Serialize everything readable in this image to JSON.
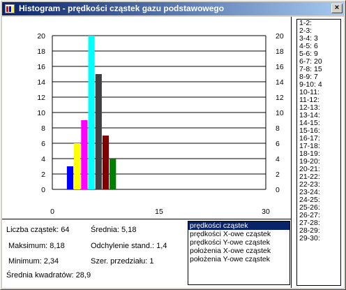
{
  "window": {
    "title": "Histogram - prędkości cząstek gazu podstawowego",
    "close_label": "×"
  },
  "chart_data": {
    "type": "bar",
    "xlim": [
      0,
      30
    ],
    "ylim": [
      0,
      20
    ],
    "x_ticks": [
      "0",
      "15",
      "30"
    ],
    "y_ticks": [
      "0",
      "2",
      "4",
      "6",
      "8",
      "10",
      "12",
      "14",
      "16",
      "18",
      "20"
    ],
    "grid": true,
    "bars": [
      {
        "bin": "2-3",
        "x": 2.5,
        "value": 3,
        "color": "#0000ff"
      },
      {
        "bin": "3-4",
        "x": 3.5,
        "value": 6,
        "color": "#ffff00"
      },
      {
        "bin": "4-5",
        "x": 4.5,
        "value": 9,
        "color": "#ff00ff"
      },
      {
        "bin": "5-6",
        "x": 5.5,
        "value": 20,
        "color": "#00ffff"
      },
      {
        "bin": "6-7",
        "x": 6.5,
        "value": 15,
        "color": "#404040"
      },
      {
        "bin": "7-8",
        "x": 7.5,
        "value": 7,
        "color": "#800000"
      },
      {
        "bin": "8-9",
        "x": 8.5,
        "value": 4,
        "color": "#008000"
      }
    ]
  },
  "stats": {
    "count": "Liczba cząstek: 64",
    "mean": "Średnia: 5,18",
    "max": "Maksimum: 8,18",
    "std": "Odchylenie stand.: 1,4",
    "min": "Minimum: 2,34",
    "interval": "Szer. przedziału: 1",
    "mean_sq": "Średnia kwadratów: 28,9"
  },
  "velocity_list": {
    "items": [
      "prędkości cząstek",
      "prędkości X-owe cząstek",
      "prędkości Y-owe cząstek",
      "położenia X-owe cząstek",
      "położenia Y-owe cząstek"
    ],
    "selected_index": 0
  },
  "intervals_list": {
    "items": [
      "1-2:",
      "2-3:",
      "3-4: 3",
      "4-5: 6",
      "5-6: 9",
      "6-7: 20",
      "7-8: 15",
      "8-9: 7",
      "9-10: 4",
      "10-11:",
      "11-12:",
      "12-13:",
      "13-14:",
      "14-15:",
      "15-16:",
      "16-17:",
      "17-18:",
      "18-19:",
      "19-20:",
      "20-21:",
      "21-22:",
      "22-23:",
      "23-24:",
      "24-25:",
      "25-26:",
      "26-27:",
      "27-28:",
      "28-29:",
      "29-30:"
    ]
  }
}
